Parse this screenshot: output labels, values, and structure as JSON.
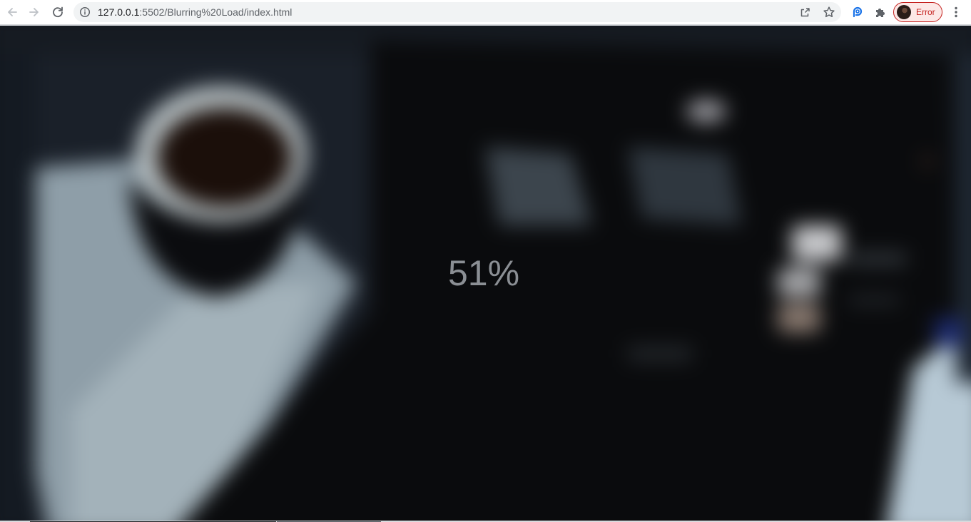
{
  "browser": {
    "url_host": "127.0.0.1",
    "url_path": ":5502/Blurring%20Load/index.html",
    "profile_status": "Error",
    "icons": {
      "back": "arrow-left-icon",
      "forward": "arrow-right-icon",
      "reload": "reload-icon",
      "site_info": "info-icon",
      "share": "share-icon",
      "bookmark": "star-icon",
      "extension_1": "extension-p-icon",
      "extensions": "puzzle-icon",
      "menu": "more-vertical-icon"
    },
    "colors": {
      "error": "#c5221f",
      "extension_accent": "#1a73e8"
    }
  },
  "page": {
    "loading_percent_text": "51%",
    "loading_percent": 51,
    "background_description_color": "#0e1013"
  }
}
